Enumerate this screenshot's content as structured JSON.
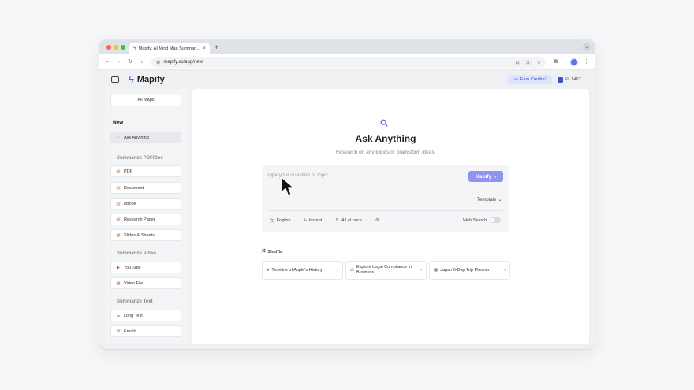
{
  "browser": {
    "tab_title": "Mapify: AI Mind Map Summari...",
    "tab_close": "×",
    "new_tab": "+",
    "tab_menu": "⌄",
    "url": "mapify.so/app/new",
    "icons": [
      "back-icon",
      "forward-icon",
      "reload-icon",
      "home-icon",
      "site-info-icon",
      "install-icon",
      "translate-icon",
      "bookmark-star-icon",
      "extensions-icon",
      "profile-icon",
      "menu-icon"
    ]
  },
  "app": {
    "logo_name": "Mapify",
    "earn_credits": "Earn Credits!",
    "credits": "5467",
    "accent": "#4b5cf0"
  },
  "sidebar": {
    "all_maps": "All Maps",
    "new_label": "New",
    "ask_anything": "Ask Anything",
    "section_pdf": "Summarize PDF/Doc",
    "pdf_items": [
      "PDF",
      "Document",
      "eBook",
      "Research Paper",
      "Slides & Sheets"
    ],
    "section_video": "Summarize Video",
    "video_items": [
      "YouTube",
      "Video File"
    ],
    "section_text": "Summarize Text",
    "text_items": [
      "Long Text",
      "Emails"
    ]
  },
  "main": {
    "title": "Ask Anything",
    "subtitle": "Research on any topics or brainstorm ideas.",
    "input_placeholder": "Type your question or topic...",
    "mapify_button": "Mapify",
    "template": "Template",
    "language": "English",
    "mode": "Instant",
    "output": "All at once",
    "web_search": "Web Search",
    "shuffle": "Shuffle",
    "suggestions": [
      "Timeline of Apple's History",
      "Explore Legal Compliance in Business",
      "Japan 5-Day Trip Planner"
    ]
  }
}
